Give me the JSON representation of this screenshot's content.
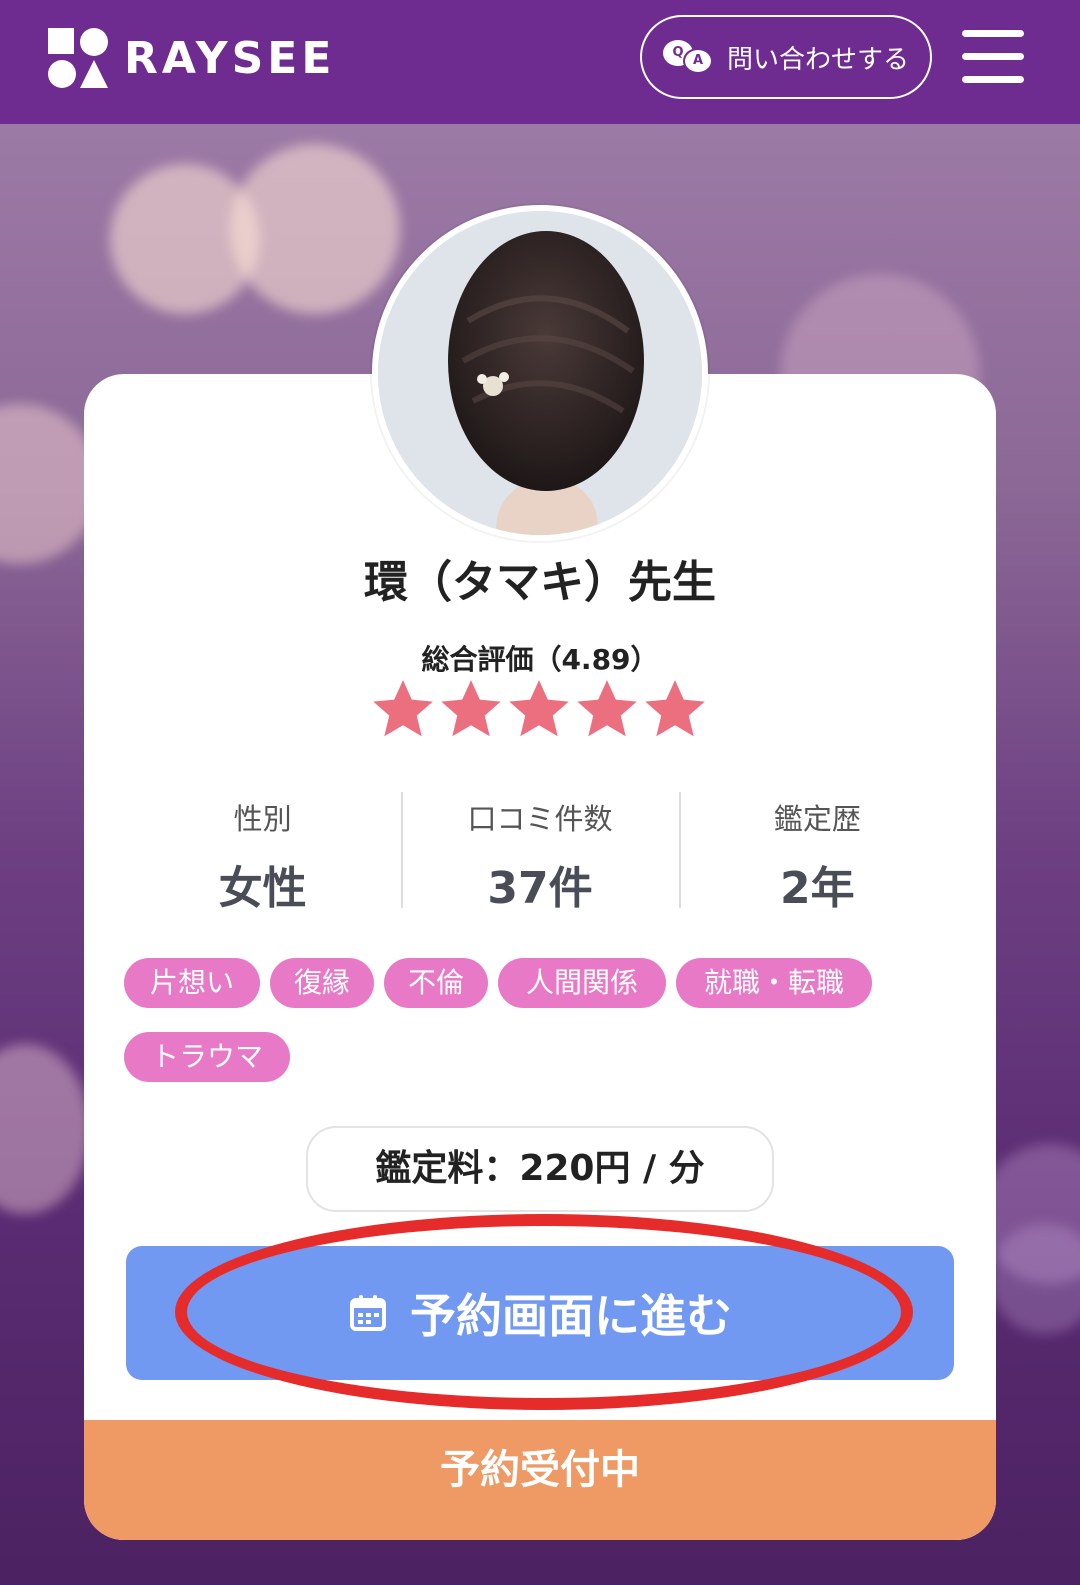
{
  "header": {
    "brand": "RAYSEE",
    "contact_label": "問い合わせする",
    "qa_badge_q": "Q",
    "qa_badge_a": "A"
  },
  "profile": {
    "name": "環（タマキ）先生",
    "rating_label": "総合評価（4.89）",
    "rating": 4.89,
    "stars_max": 5,
    "star_color": "#ec6f7f"
  },
  "stats": [
    {
      "label": "性別",
      "value": "女性"
    },
    {
      "label": "口コミ件数",
      "value": "37件"
    },
    {
      "label": "鑑定歴",
      "value": "2年"
    }
  ],
  "tags": [
    "片想い",
    "復縁",
    "不倫",
    "人間関係",
    "就職・転職",
    "トラウマ"
  ],
  "fee": "鑑定料：220円 / 分",
  "reserve_button": "予約画面に進む",
  "status": "予約受付中",
  "colors": {
    "header": "#6e2c91",
    "tag": "#e779c6",
    "button": "#7199f1",
    "status": "#ef9965",
    "highlight": "#e62b2b"
  }
}
